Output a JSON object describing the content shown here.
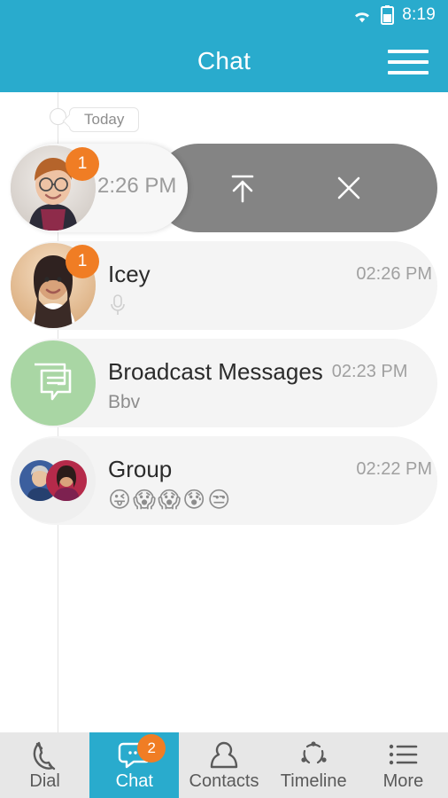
{
  "status_bar": {
    "time": "8:19",
    "wifi_icon": "wifi-icon",
    "battery_icon": "battery-icon"
  },
  "app_bar": {
    "title": "Chat",
    "menu_icon": "hamburger-menu-icon"
  },
  "timeline": {
    "date_label": "Today"
  },
  "colors": {
    "accent": "#29ABCD",
    "badge": "#F07D24",
    "card": "#f4f4f4",
    "action_panel": "#848484",
    "broadcast_avatar": "#a9d6a4",
    "nav_background": "#e7e7e7"
  },
  "swipe_actions": {
    "pin_label": "pin-to-top",
    "pin_icon": "arrow-up-to-bar-icon",
    "close_label": "close",
    "close_icon": "close-x-icon"
  },
  "chats": [
    {
      "name": "",
      "time": "2:26 PM",
      "preview": "",
      "badge": "1",
      "avatar": "boy-glasses-photo",
      "state": "swiped-open"
    },
    {
      "name": "Icey",
      "time": "02:26 PM",
      "preview": "",
      "preview_icon": "microphone-icon",
      "badge": "1",
      "avatar": "woman-smiling-photo",
      "state": "normal"
    },
    {
      "name": "Broadcast Messages",
      "time": "02:23 PM",
      "preview": "Bbv",
      "badge": "",
      "avatar": "broadcast-bubbles-icon",
      "state": "normal"
    },
    {
      "name": "Group",
      "time": "02:22 PM",
      "preview": "😜😱😱😰😒",
      "badge": "",
      "avatar": "group-two-members-photo",
      "state": "normal"
    }
  ],
  "bottom_nav": [
    {
      "label": "Dial",
      "icon": "phone-handset-icon",
      "badge": "",
      "active": false
    },
    {
      "label": "Chat",
      "icon": "chat-bubble-icon",
      "badge": "2",
      "active": true
    },
    {
      "label": "Contacts",
      "icon": "person-icon",
      "badge": "",
      "active": false
    },
    {
      "label": "Timeline",
      "icon": "dotted-circle-icon",
      "badge": "",
      "active": false
    },
    {
      "label": "More",
      "icon": "list-icon",
      "badge": "",
      "active": false
    }
  ]
}
